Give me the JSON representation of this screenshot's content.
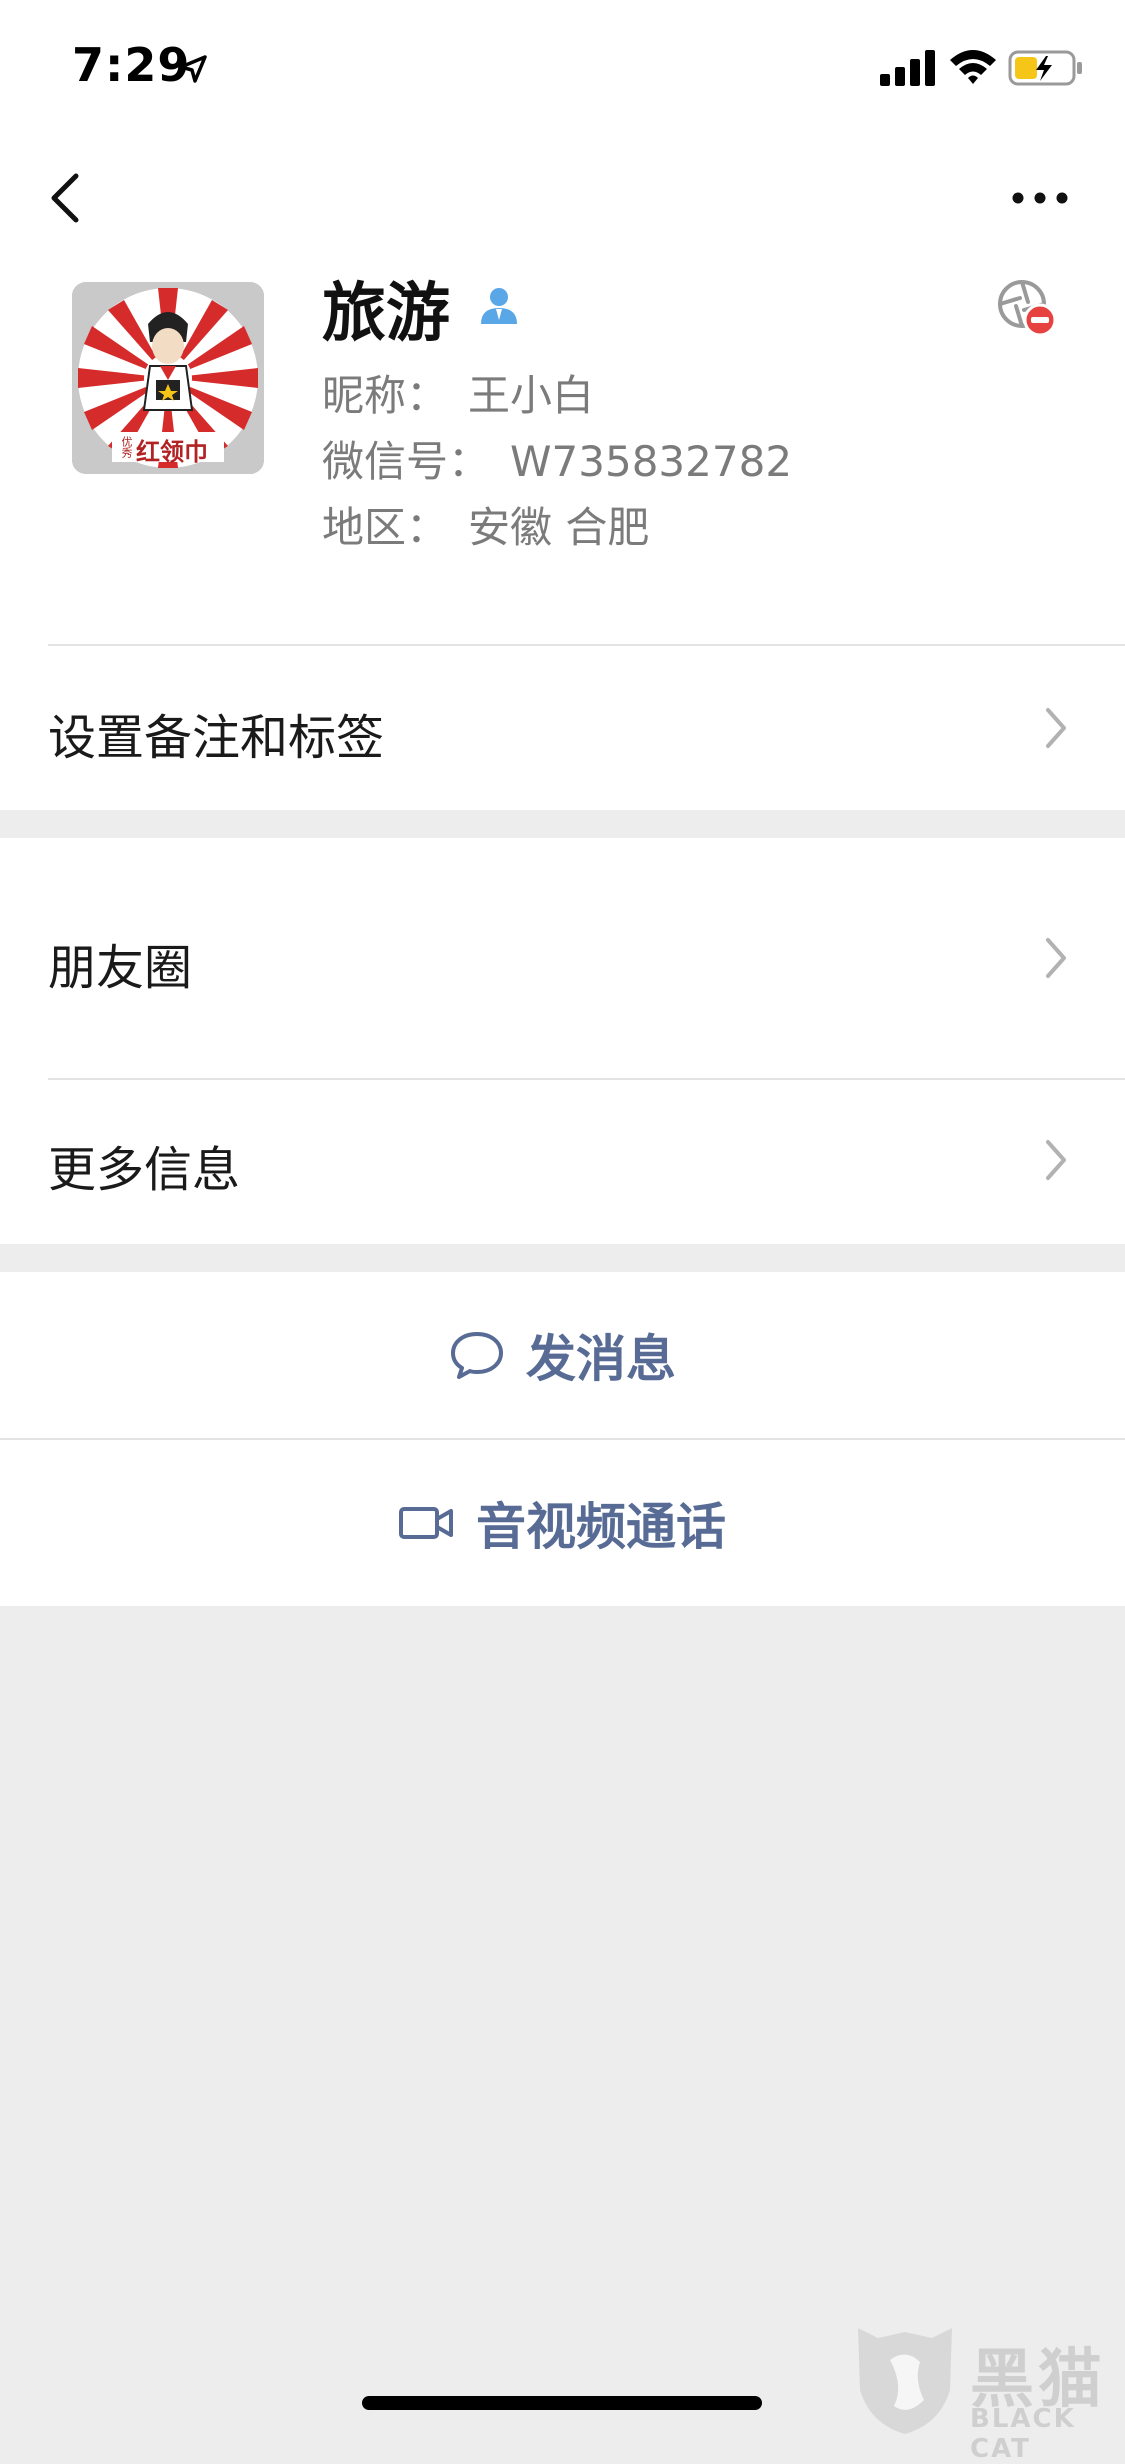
{
  "status_bar": {
    "time": "7:29",
    "icons": [
      "location-arrow-icon",
      "signal-icon",
      "wifi-icon",
      "battery-charging-icon"
    ]
  },
  "nav": {
    "back_icon": "chevron-left-icon",
    "more_icon": "more-dots-icon"
  },
  "profile": {
    "name": "旅游",
    "nickname_label": "昵称：",
    "nickname": "王小白",
    "wechat_id_label": "微信号：",
    "wechat_id": "W735832782",
    "region_label": "地区：",
    "region": "安徽 合肥",
    "avatar_text": "红领巾",
    "avatar_small_text": "优秀"
  },
  "cells": {
    "remark": "设置备注和标签",
    "moments": "朋友圈",
    "more_info": "更多信息"
  },
  "actions": {
    "message": "发消息",
    "call": "音视频通话"
  },
  "watermark": {
    "cn": "黑猫",
    "en": "BLACK CAT"
  },
  "colors": {
    "link": "#576b95",
    "background": "#ededed",
    "accent_blue": "#5aa7e8",
    "stop_red": "#e64340"
  }
}
